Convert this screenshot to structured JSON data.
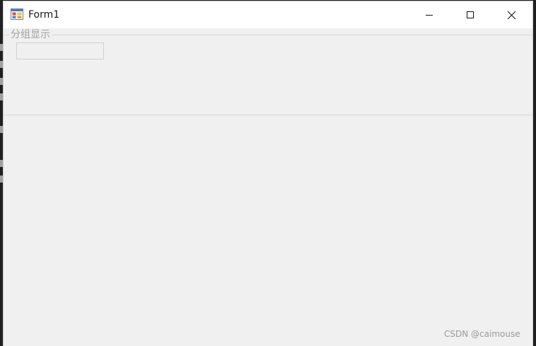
{
  "window": {
    "title": "Form1"
  },
  "groupbox": {
    "label": "分组显示"
  },
  "watermark": "CSDN @caimouse",
  "icons": {
    "app": "form-app-icon",
    "minimize": "minimize-icon",
    "maximize": "maximize-icon",
    "close": "close-icon"
  }
}
